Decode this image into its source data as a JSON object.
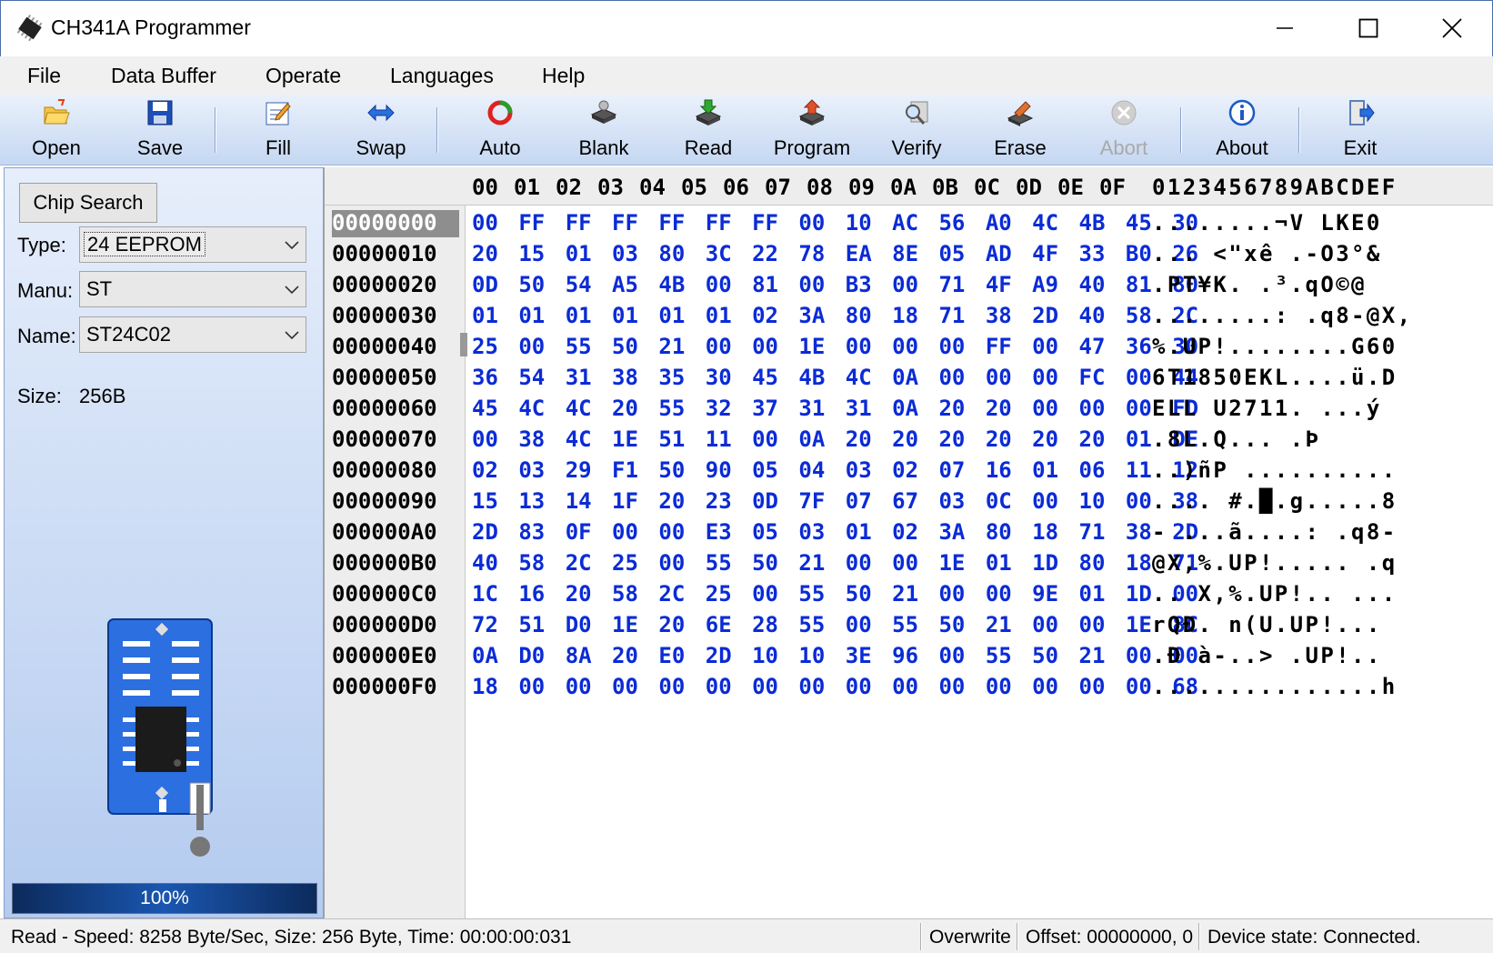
{
  "window": {
    "title": "CH341A Programmer"
  },
  "menu": [
    "File",
    "Data Buffer",
    "Operate",
    "Languages",
    "Help"
  ],
  "toolbar": {
    "open": "Open",
    "save": "Save",
    "fill": "Fill",
    "swap": "Swap",
    "auto": "Auto",
    "blank": "Blank",
    "read": "Read",
    "program": "Program",
    "verify": "Verify",
    "erase": "Erase",
    "abort": "Abort",
    "about": "About",
    "exit": "Exit"
  },
  "left_panel": {
    "chip_search": "Chip Search",
    "type_label": "Type:",
    "type_value": "24 EEPROM",
    "manu_label": "Manu:",
    "manu_value": "ST",
    "name_label": "Name:",
    "name_value": "ST24C02",
    "size_label": "Size:",
    "size_value": "256B",
    "progress": "100%"
  },
  "hex": {
    "columns": [
      "00",
      "01",
      "02",
      "03",
      "04",
      "05",
      "06",
      "07",
      "08",
      "09",
      "0A",
      "0B",
      "0C",
      "0D",
      "0E",
      "0F"
    ],
    "ascii_header": "0123456789ABCDEF",
    "rows": [
      {
        "addr": "00000000",
        "bytes": "00 FF FF FF FF FF FF 00 10 AC 56 A0 4C 4B 45 30",
        "ascii": "........¬V LKE0"
      },
      {
        "addr": "00000010",
        "bytes": "20 15 01 03 80 3C 22 78 EA 8E 05 AD 4F 33 B0 26",
        "ascii": " ... <\"xê .-O3°&"
      },
      {
        "addr": "00000020",
        "bytes": "0D 50 54 A5 4B 00 81 00 B3 00 71 4F A9 40 81 80",
        "ascii": ".PT¥K. .³.qO©@"
      },
      {
        "addr": "00000030",
        "bytes": "01 01 01 01 01 01 02 3A 80 18 71 38 2D 40 58 2C",
        "ascii": "........: .q8-@X,"
      },
      {
        "addr": "00000040",
        "bytes": "25 00 55 50 21 00 00 1E 00 00 00 FF 00 47 36 30",
        "ascii": "%.UP!........G60"
      },
      {
        "addr": "00000050",
        "bytes": "36 54 31 38 35 30 45 4B 4C 0A 00 00 00 FC 00 44",
        "ascii": "6T1850EKL....ü.D"
      },
      {
        "addr": "00000060",
        "bytes": "45 4C 4C 20 55 32 37 31 31 0A 20 20 00 00 00 FD",
        "ascii": "ELL U2711.  ...ý"
      },
      {
        "addr": "00000070",
        "bytes": "00 38 4C 1E 51 11 00 0A 20 20 20 20 20 20 01 DE",
        "ascii": ".8L.Q...      .Þ"
      },
      {
        "addr": "00000080",
        "bytes": "02 03 29 F1 50 90 05 04 03 02 07 16 01 06 11 12",
        "ascii": "..)ñP .........."
      },
      {
        "addr": "00000090",
        "bytes": "15 13 14 1F 20 23 0D 7F 07 67 03 0C 00 10 00 38",
        "ascii": ".... #.█.g.....8"
      },
      {
        "addr": "000000A0",
        "bytes": "2D 83 0F 00 00 E3 05 03 01 02 3A 80 18 71 38 2D",
        "ascii": "- ...ã....: .q8-"
      },
      {
        "addr": "000000B0",
        "bytes": "40 58 2C 25 00 55 50 21 00 00 1E 01 1D 80 18 71",
        "ascii": "@X,%.UP!..... .q"
      },
      {
        "addr": "000000C0",
        "bytes": "1C 16 20 58 2C 25 00 55 50 21 00 00 9E 01 1D 00",
        "ascii": ".. X,%.UP!.. ..."
      },
      {
        "addr": "000000D0",
        "bytes": "72 51 D0 1E 20 6E 28 55 00 55 50 21 00 00 1E 8C",
        "ascii": "rQÐ. n(U.UP!..."
      },
      {
        "addr": "000000E0",
        "bytes": "0A D0 8A 20 E0 2D 10 10 3E 96 00 55 50 21 00 00",
        "ascii": ".Ð  à-..> .UP!.."
      },
      {
        "addr": "000000F0",
        "bytes": "18 00 00 00 00 00 00 00 00 00 00 00 00 00 00 68",
        "ascii": "...............h"
      }
    ]
  },
  "status": {
    "left": "Read - Speed: 8258 Byte/Sec, Size: 256 Byte, Time: 00:00:00:031",
    "mode": "Overwrite",
    "offset": "Offset: 00000000, 0",
    "device": "Device state: Connected."
  }
}
